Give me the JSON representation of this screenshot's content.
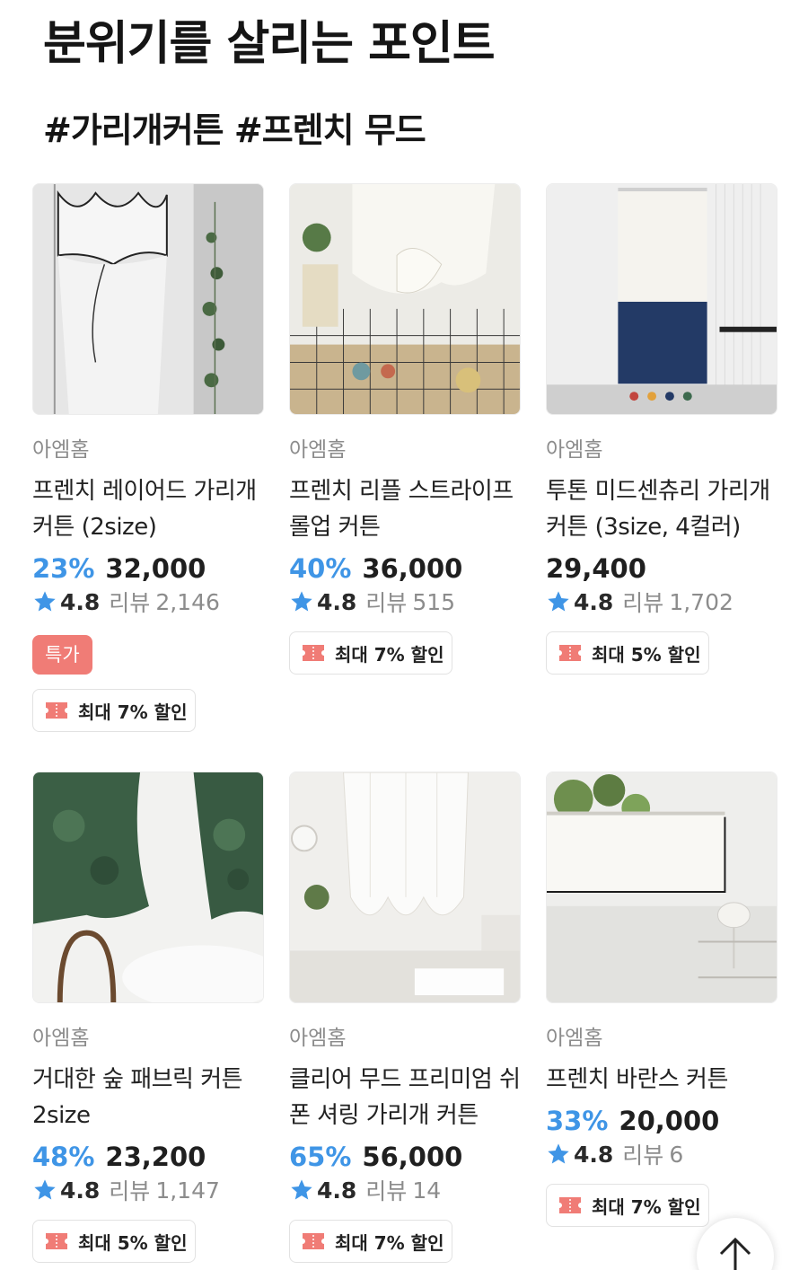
{
  "section": {
    "title": "분위기를 살리는 포인트",
    "subtitle": "#가리개커튼 #프렌치 무드"
  },
  "products": [
    {
      "brand": "아엠홈",
      "name": "프렌치 레이어드 가리개커튼 (2size)",
      "discount": "23%",
      "price": "32,000",
      "rating": "4.8",
      "review_label": "리뷰",
      "review_count": "2,146",
      "badge": "특가",
      "coupon": "최대 7% 할인"
    },
    {
      "brand": "아엠홈",
      "name": "프렌치 리플 스트라이프 롤업 커튼",
      "discount": "40%",
      "price": "36,000",
      "rating": "4.8",
      "review_label": "리뷰",
      "review_count": "515",
      "coupon": "최대 7% 할인"
    },
    {
      "brand": "아엠홈",
      "name": "투톤 미드센츄리 가리개 커튼 (3size, 4컬러)",
      "price": "29,400",
      "rating": "4.8",
      "review_label": "리뷰",
      "review_count": "1,702",
      "coupon": "최대 5% 할인"
    },
    {
      "brand": "아엠홈",
      "name": "거대한 숲 패브릭 커튼 2size",
      "discount": "48%",
      "price": "23,200",
      "rating": "4.8",
      "review_label": "리뷰",
      "review_count": "1,147",
      "coupon": "최대 5% 할인"
    },
    {
      "brand": "아엠홈",
      "name": "클리어 무드 프리미엄 쉬폰 셔링 가리개 커튼",
      "discount": "65%",
      "price": "56,000",
      "rating": "4.8",
      "review_label": "리뷰",
      "review_count": "14",
      "coupon": "최대 7% 할인"
    },
    {
      "brand": "아엠홈",
      "name": "프렌치 바란스 커튼",
      "discount": "33%",
      "price": "20,000",
      "rating": "4.8",
      "review_label": "리뷰",
      "review_count": "6",
      "coupon": "최대 7% 할인"
    }
  ],
  "icons": {
    "star": "star-icon",
    "coupon": "coupon-icon",
    "scroll_top": "arrow-up-icon"
  },
  "colors": {
    "discount": "#3f95e6",
    "star": "#3f95e6",
    "special_badge": "#f07c76",
    "coupon_icon": "#f07c76"
  }
}
